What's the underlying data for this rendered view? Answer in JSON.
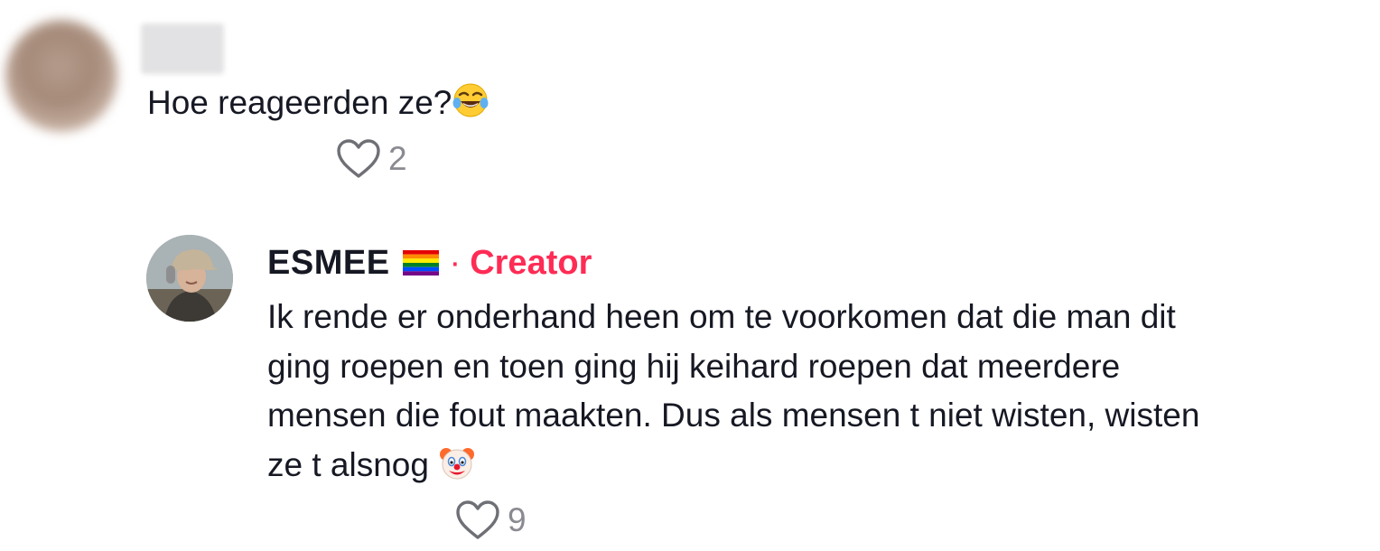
{
  "comment": {
    "text": "Hoe reageerden ze?",
    "emoji_icon": "face-with-tears-of-joy-icon",
    "likes": "2"
  },
  "reply": {
    "username": "ESMEE",
    "flag_icon": "rainbow-flag-icon",
    "separator": "·",
    "role_label": "Creator",
    "role_color": "#fe2c55",
    "lines": [
      "Ik rende er onderhand heen om te voorkomen dat die man dit",
      "ging roepen en toen ging hij keihard roepen dat meerdere",
      "mensen die fout maakten. Dus als mensen t niet wisten, wisten",
      "ze t alsnog"
    ],
    "emoji_icon": "clown-face-icon",
    "likes": "9"
  }
}
